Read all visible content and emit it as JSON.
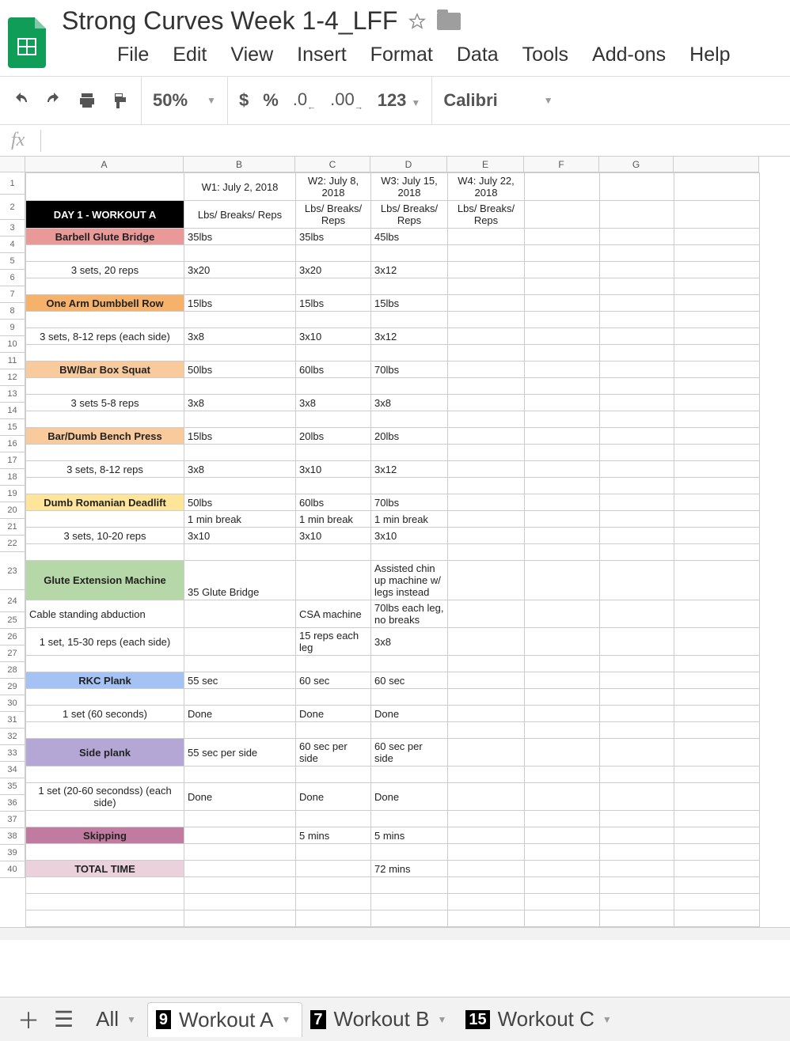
{
  "doc_title": "Strong Curves Week 1-4_LFF",
  "menus": [
    "File",
    "Edit",
    "View",
    "Insert",
    "Format",
    "Data",
    "Tools",
    "Add-ons",
    "Help"
  ],
  "toolbar": {
    "zoom": "50%",
    "format": "123",
    "font": "Calibri"
  },
  "columns": [
    "A",
    "B",
    "C",
    "D",
    "E",
    "F",
    "G"
  ],
  "widths": [
    200,
    141,
    95,
    97,
    97,
    95,
    94,
    108
  ],
  "row_count": 40,
  "vary_height_rows": {
    "1": 28,
    "2": 32,
    "23": 48,
    "24": 28
  },
  "default_row_h": 21,
  "rows": [
    {
      "n": 1,
      "c": {
        "B": "W1: July 2, 2018",
        "C": "W2: July 8, 2018",
        "D": "W3: July 15, 2018",
        "E": "W4: July 22, 2018"
      }
    },
    {
      "n": 2,
      "c": {
        "A": "DAY 1 - WORKOUT A",
        "B": "Lbs/ Breaks/ Reps",
        "C": "Lbs/ Breaks/ Reps",
        "D": "Lbs/ Breaks/ Reps",
        "E": "Lbs/ Breaks/ Reps"
      },
      "cls": {
        "A": "header-black"
      }
    },
    {
      "n": 3,
      "c": {
        "A": "Barbell Glute Bridge",
        "B": "35lbs",
        "C": "35lbs",
        "D": "45lbs"
      },
      "cls": {
        "A": "bg-pink bold center"
      }
    },
    {
      "n": 5,
      "c": {
        "A": "3 sets, 20 reps",
        "B": "3x20",
        "C": "3x20",
        "D": "3x12"
      }
    },
    {
      "n": 7,
      "c": {
        "A": "One Arm Dumbbell Row",
        "B": "15lbs",
        "C": "15lbs",
        "D": "15lbs"
      },
      "cls": {
        "A": "bg-orange bold center"
      }
    },
    {
      "n": 9,
      "c": {
        "A": "3 sets, 8-12 reps (each side)",
        "B": "3x8",
        "C": "3x10",
        "D": "3x12"
      }
    },
    {
      "n": 11,
      "c": {
        "A": "BW/Bar Box Squat",
        "B": "50lbs",
        "C": "60lbs",
        "D": "70lbs"
      },
      "cls": {
        "A": "bg-peach bold center"
      }
    },
    {
      "n": 13,
      "c": {
        "A": "3 sets 5-8 reps",
        "B": "3x8",
        "C": "3x8",
        "D": "3x8"
      }
    },
    {
      "n": 15,
      "c": {
        "A": "Bar/Dumb Bench Press",
        "B": "15lbs",
        "C": "20lbs",
        "D": "20lbs"
      },
      "cls": {
        "A": "bg-peach bold center"
      }
    },
    {
      "n": 17,
      "c": {
        "A": "3 sets, 8-12 reps",
        "B": "3x8",
        "C": "3x10",
        "D": "3x12"
      }
    },
    {
      "n": 19,
      "c": {
        "A": "Dumb Romanian Deadlift",
        "B": "50lbs",
        "C": "60lbs",
        "D": "70lbs"
      },
      "cls": {
        "A": "bg-yellow bold center"
      }
    },
    {
      "n": 20,
      "c": {
        "B": "1 min break",
        "C": "1 min break",
        "D": "1 min break"
      }
    },
    {
      "n": 21,
      "c": {
        "A": "3 sets, 10-20 reps",
        "B": "3x10",
        "C": "3x10",
        "D": "3x10"
      }
    },
    {
      "n": 23,
      "c": {
        "A": "Glute Extension Machine",
        "B": "35 Glute Bridge",
        "D": "Assisted chin up machine w/ legs instead"
      },
      "cls": {
        "A": "bg-green bold center"
      }
    },
    {
      "n": 24,
      "c": {
        "A": "Cable standing abduction",
        "C": "CSA machine",
        "D": "70lbs each leg, no breaks"
      }
    },
    {
      "n": 25,
      "c": {
        "A": "1 set, 15-30 reps (each side)",
        "C": "15 reps each leg",
        "D": "3x8"
      }
    },
    {
      "n": 27,
      "c": {
        "A": "RKC Plank",
        "B": "55 sec",
        "C": "60 sec",
        "D": "60 sec"
      },
      "cls": {
        "A": "bg-blue bold center"
      }
    },
    {
      "n": 29,
      "c": {
        "A": "1 set (60 seconds)",
        "B": "Done",
        "C": "Done",
        "D": "Done"
      }
    },
    {
      "n": 31,
      "c": {
        "A": "Side plank",
        "B": "55 sec per side",
        "C": "60 sec per side",
        "D": "60 sec per side"
      },
      "cls": {
        "A": "bg-purple bold center"
      }
    },
    {
      "n": 33,
      "c": {
        "A": "1 set (20-60 secondss) (each side)",
        "B": "Done",
        "C": "Done",
        "D": "Done"
      }
    },
    {
      "n": 35,
      "c": {
        "A": "Skipping",
        "C": "5 mins",
        "D": "5 mins"
      },
      "cls": {
        "A": "bg-magenta bold center"
      }
    },
    {
      "n": 37,
      "c": {
        "A": "TOTAL TIME",
        "D": "72 mins"
      },
      "cls": {
        "A": "bg-lpink bold center"
      }
    }
  ],
  "center_cols_header_rows": [
    "B",
    "C",
    "D",
    "E"
  ],
  "tabs": [
    {
      "label": "All",
      "badge": ""
    },
    {
      "label": "Workout A",
      "badge": "9",
      "active": true
    },
    {
      "label": "Workout B",
      "badge": "7"
    },
    {
      "label": "Workout C",
      "badge": "15"
    }
  ]
}
